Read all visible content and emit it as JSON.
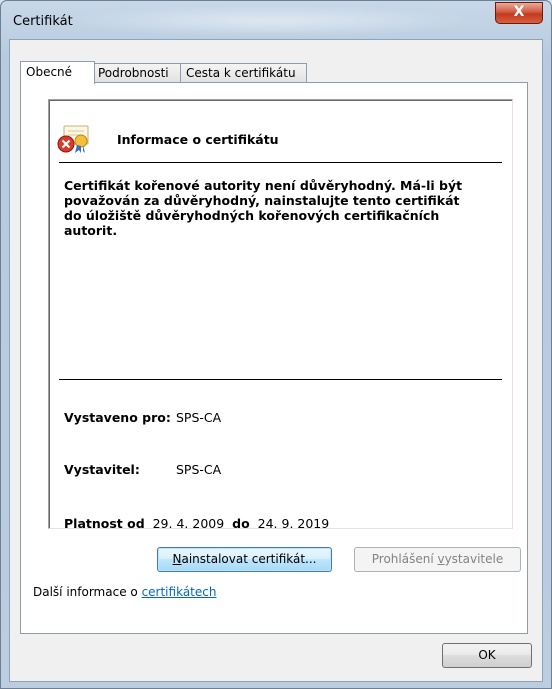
{
  "window": {
    "title": "Certifikát",
    "close_glyph": "X"
  },
  "tabs": [
    {
      "label": "Obecné",
      "active": true
    },
    {
      "label": "Podrobnosti",
      "active": false
    },
    {
      "label": "Cesta k certifikátu",
      "active": false
    }
  ],
  "info": {
    "heading": "Informace o certifikátu",
    "message": "Certifikát kořenové autority není důvěryhodný. Má-li být považován za důvěryhodný, nainstalujte tento certifikát do úložiště důvěryhodných kořenových certifikačních autorit.",
    "issued_to_label": "Vystaveno pro:",
    "issued_to_value": "SPS-CA",
    "issuer_label": "Vystavitel:",
    "issuer_value": "SPS-CA",
    "valid_from_label": "Platnost od",
    "valid_from_value": "29. 4. 2009",
    "valid_to_label": "do",
    "valid_to_value": "24. 9. 2019"
  },
  "buttons": {
    "install_mnemonic": "N",
    "install_rest": "ainstalovat certifikát...",
    "statement_prefix": "Prohlášení ",
    "statement_mnemonic": "v",
    "statement_rest": "ystavitele",
    "ok": "OK"
  },
  "more_info": {
    "prefix": "Další informace o ",
    "link": "certifikátech"
  },
  "colors": {
    "link": "#0066cc",
    "close_button": "#c23a1e",
    "panel_border": "#8e9caf"
  }
}
